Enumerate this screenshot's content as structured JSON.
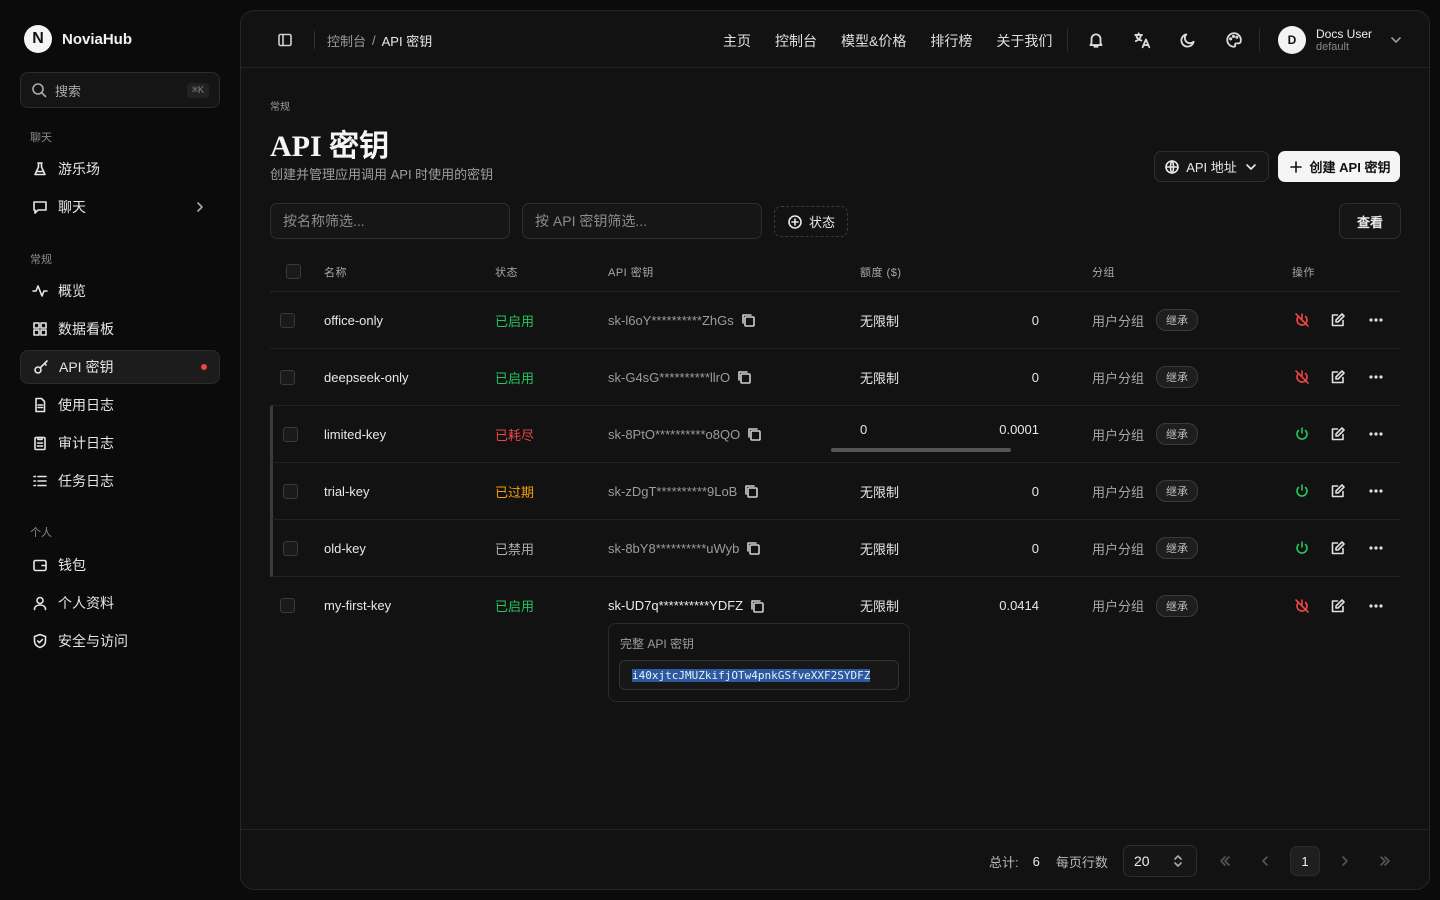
{
  "brand": {
    "name": "NoviaHub",
    "logo_letter": "N"
  },
  "search": {
    "placeholder": "搜索",
    "shortcut": "⌘K"
  },
  "sidebar": {
    "sections": [
      {
        "title": "聊天",
        "items": [
          {
            "label": "游乐场",
            "icon": "flask-icon"
          },
          {
            "label": "聊天",
            "icon": "chat-icon"
          }
        ]
      },
      {
        "title": "常规",
        "items": [
          {
            "label": "概览",
            "icon": "activity-icon"
          },
          {
            "label": "数据看板",
            "icon": "dashboard-icon"
          },
          {
            "label": "API 密钥",
            "icon": "key-icon",
            "active": true
          },
          {
            "label": "使用日志",
            "icon": "file-icon"
          },
          {
            "label": "审计日志",
            "icon": "clipboard-icon"
          },
          {
            "label": "任务日志",
            "icon": "list-icon"
          }
        ]
      },
      {
        "title": "个人",
        "items": [
          {
            "label": "钱包",
            "icon": "wallet-icon"
          },
          {
            "label": "个人资料",
            "icon": "user-icon"
          },
          {
            "label": "安全与访问",
            "icon": "shield-icon"
          }
        ]
      }
    ]
  },
  "breadcrumb": {
    "parent": "控制台",
    "separator": "/",
    "current": "API 密钥"
  },
  "topnav": [
    "主页",
    "控制台",
    "模型&价格",
    "排行榜",
    "关于我们"
  ],
  "user": {
    "initial": "D",
    "name": "Docs User",
    "role": "default"
  },
  "page": {
    "category": "常规",
    "title": "API 密钥",
    "subtitle": "创建并管理应用调用 API 时使用的密钥",
    "api_address_label": "API 地址",
    "create_label": "创建 API 密钥",
    "filter_name_placeholder": "按名称筛选...",
    "filter_key_placeholder": "按 API 密钥筛选...",
    "status_filter_label": "状态",
    "view_label": "查看"
  },
  "table": {
    "headers": {
      "name": "名称",
      "status": "状态",
      "key": "API 密钥",
      "quota": "额度 ($)",
      "group": "分组",
      "actions": "操作"
    },
    "rows": [
      {
        "name": "office-only",
        "status": "已启用",
        "status_color": "#22c55e",
        "key": "sk-l6oY**********ZhGs",
        "quota": "无限制",
        "used": "0",
        "group": "用户分组",
        "badge": "继承",
        "toggle": "disable"
      },
      {
        "name": "deepseek-only",
        "status": "已启用",
        "status_color": "#22c55e",
        "key": "sk-G4sG**********llrO",
        "quota": "无限制",
        "used": "0",
        "group": "用户分组",
        "badge": "继承",
        "toggle": "disable"
      },
      {
        "name": "limited-key",
        "status": "已耗尽",
        "status_color": "#ef4444",
        "key": "sk-8PtO**********o8QO",
        "quota": "0",
        "used": "0.0001",
        "quota_fraction": 1.0,
        "group": "用户分组",
        "badge": "继承",
        "toggle": "enable"
      },
      {
        "name": "trial-key",
        "status": "已过期",
        "status_color": "#f59e0b",
        "key": "sk-zDgT**********9LoB",
        "quota": "无限制",
        "used": "0",
        "group": "用户分组",
        "badge": "继承",
        "toggle": "enable"
      },
      {
        "name": "old-key",
        "status": "已禁用",
        "status_color": "#b0b0b0",
        "key": "sk-8bY8**********uWyb",
        "quota": "无限制",
        "used": "0",
        "group": "用户分组",
        "badge": "继承",
        "toggle": "enable"
      },
      {
        "name": "my-first-key",
        "status": "已启用",
        "status_color": "#22c55e",
        "key": "sk-UD7q**********YDFZ",
        "quota": "无限制",
        "used": "0.0414",
        "group": "用户分组",
        "badge": "继承",
        "toggle": "disable"
      }
    ]
  },
  "popover": {
    "title": "完整 API 密钥",
    "value": "i40xjtcJMUZkifjOTw4pnkGSfveXXF2SYDFZ"
  },
  "pagination": {
    "total_label": "总计:",
    "total": "6",
    "rows_label": "每页行数",
    "rows_per_page": "20",
    "current_page": "1"
  }
}
